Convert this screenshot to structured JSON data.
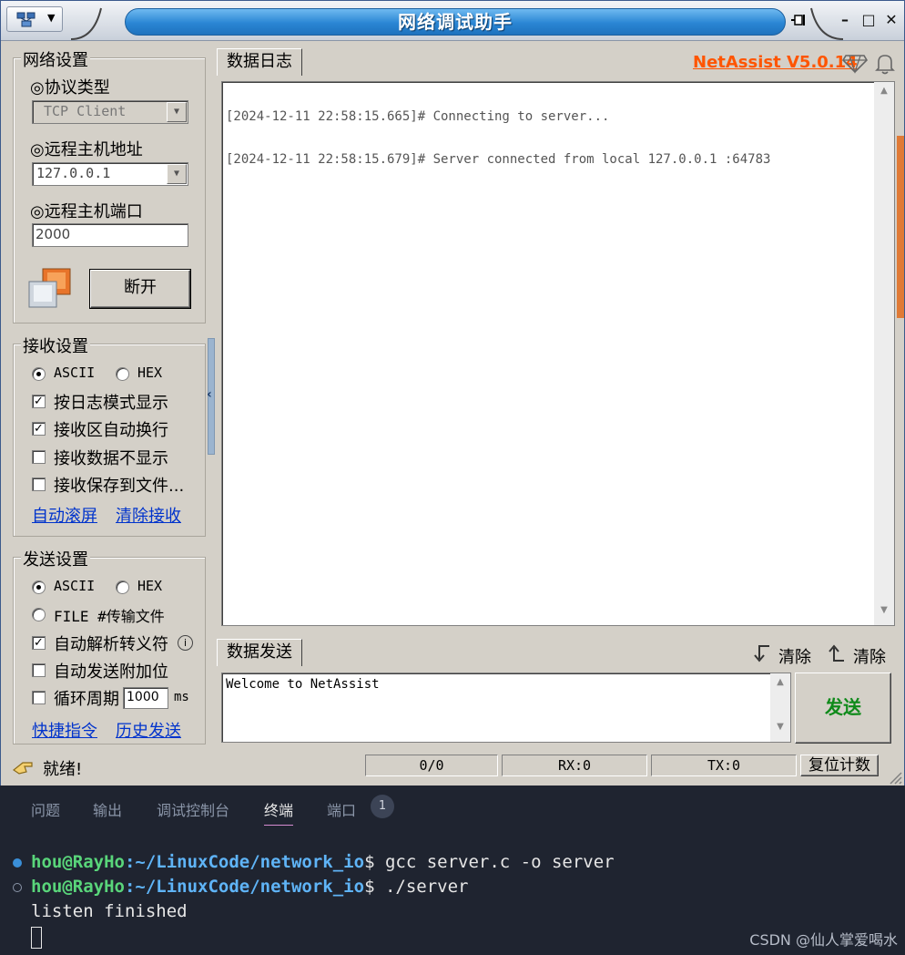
{
  "window": {
    "title": "网络调试助手",
    "brand": "NetAssist V5.0.14",
    "brand_color": "#ff5500"
  },
  "network": {
    "legend": "网络设置",
    "protocol_label": "◎协议类型",
    "protocol_value": "TCP Client",
    "host_label": "◎远程主机地址",
    "host_value": "127.0.0.1",
    "port_label": "◎远程主机端口",
    "port_value": "2000",
    "disconnect_label": "断开"
  },
  "receive": {
    "legend": "接收设置",
    "ascii_label": "ASCII",
    "hex_label": "HEX",
    "mode": "ASCII",
    "options": [
      {
        "label": "按日志模式显示",
        "checked": true
      },
      {
        "label": "接收区自动换行",
        "checked": true
      },
      {
        "label": "接收数据不显示",
        "checked": false
      },
      {
        "label": "接收保存到文件...",
        "checked": false
      }
    ],
    "auto_scroll_link": "自动滚屏",
    "clear_link": "清除接收"
  },
  "send": {
    "legend": "发送设置",
    "ascii_label": "ASCII",
    "hex_label": "HEX",
    "file_label": "FILE #传输文件",
    "mode": "ASCII",
    "options": [
      {
        "label": "自动解析转义符",
        "checked": true
      },
      {
        "label": "自动发送附加位",
        "checked": false
      },
      {
        "label": "循环周期",
        "checked": false
      }
    ],
    "period_value": "1000",
    "period_unit": "ms",
    "shortcut_link": "快捷指令",
    "history_link": "历史发送"
  },
  "log": {
    "tab": "数据日志",
    "lines": [
      "[2024-12-11 22:58:15.665]# Connecting to server...",
      "[2024-12-11 22:58:15.679]# Server connected from local 127.0.0.1 :64783"
    ]
  },
  "sendpane": {
    "tab": "数据发送",
    "clear1": "清除",
    "clear2": "清除",
    "text": "Welcome to NetAssist",
    "send_label": "发送",
    "send_color": "#0f8a1a"
  },
  "statusbar": {
    "ready": "就绪!",
    "count": "0/0",
    "rx": "RX:0",
    "tx": "TX:0",
    "reset": "复位计数"
  },
  "panel": {
    "tabs": [
      "问题",
      "输出",
      "调试控制台",
      "终端",
      "端口"
    ],
    "active_tab": "终端",
    "badge": "1"
  },
  "terminal": {
    "lines": [
      {
        "user": "hou@RayHo",
        "path": ":~/LinuxCode/network_io",
        "cmd": "$ gcc server.c -o server",
        "dot": "#3a8fd8"
      },
      {
        "user": "hou@RayHo",
        "path": ":~/LinuxCode/network_io",
        "cmd": "$ ./server",
        "dot": "#1f2430"
      }
    ],
    "output": "listen finished"
  },
  "watermark": "CSDN @仙人掌爱喝水"
}
